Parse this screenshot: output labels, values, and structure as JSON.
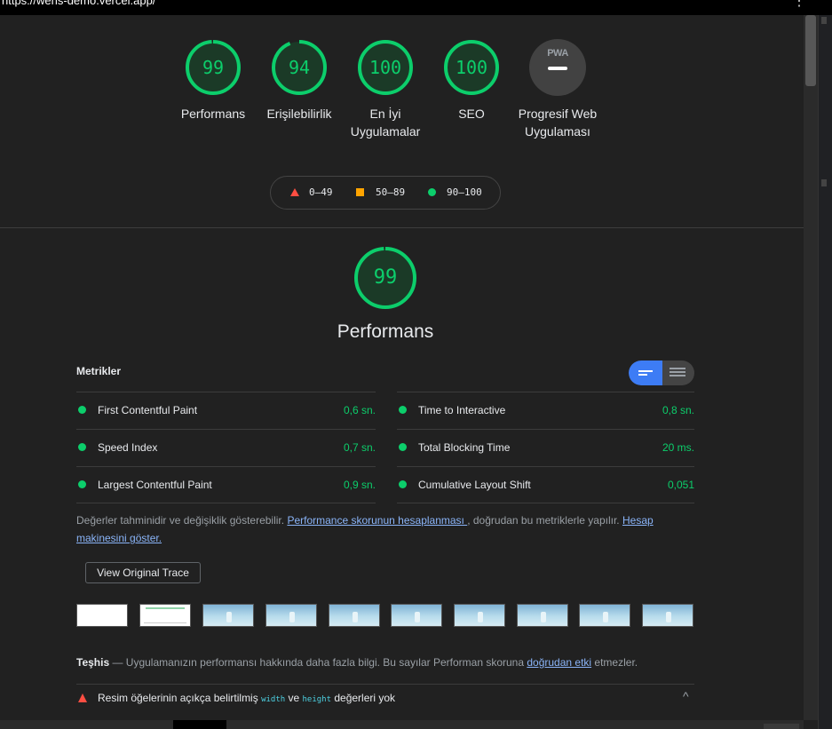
{
  "browser": {
    "url": "https://wens-demo.vercel.app/",
    "menu_icon": "⋮"
  },
  "summary": {
    "gauges": [
      {
        "score": "99",
        "label": "Performans"
      },
      {
        "score": "94",
        "label": "Erişilebilirlik"
      },
      {
        "score": "100",
        "label": "En İyi Uygulamalar"
      },
      {
        "score": "100",
        "label": "SEO"
      }
    ],
    "pwa": {
      "badge": "PWA",
      "label": "Progresif Web Uygulaması"
    }
  },
  "legend": {
    "fail": "0–49",
    "average": "50–89",
    "pass": "90–100"
  },
  "performance": {
    "score": "99",
    "score_fraction": 0.99,
    "title": "Performans",
    "metrics_title": "Metrikler",
    "metrics": [
      {
        "label": "First Contentful Paint",
        "value": "0,6 sn."
      },
      {
        "label": "Time to Interactive",
        "value": "0,8 sn."
      },
      {
        "label": "Speed Index",
        "value": "0,7 sn."
      },
      {
        "label": "Total Blocking Time",
        "value": "20 ms."
      },
      {
        "label": "Largest Contentful Paint",
        "value": "0,9 sn."
      },
      {
        "label": "Cumulative Layout Shift",
        "value": "0,051"
      }
    ],
    "note": {
      "text1": "Değerler tahminidir ve değişiklik gösterebilir. ",
      "link1": "Performance skorunun hesaplanması ",
      "text2": ", doğrudan bu metriklerle yapılır. ",
      "link2": "Hesap makinesini göster."
    },
    "trace_button": "View Original Trace",
    "diagnostics": {
      "label": "Teşhis",
      "text": " — Uygulamanızın performansı hakkında daha fazla bilgi. Bu sayılar Performan skoruna ",
      "link": "doğrudan etki",
      "text2": " etmezler."
    },
    "audit": {
      "text1": "Resim öğelerinin açıkça belirtilmiş ",
      "code1": "width",
      "text2": " ve ",
      "code2": "height",
      "text3": " değerleri yok",
      "chevron": "^"
    }
  },
  "colors": {
    "pass": "#0cce6b",
    "average": "#ffa400",
    "fail": "#ff4e42",
    "accent": "#3d7cf5",
    "link": "#8ab4f8"
  }
}
